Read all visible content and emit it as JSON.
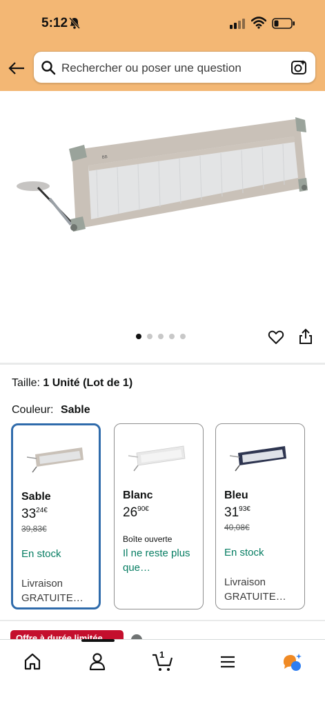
{
  "status_bar": {
    "time": "5:12"
  },
  "search": {
    "placeholder": "Rechercher ou poser une question"
  },
  "gallery": {
    "image_count": 5,
    "active_index": 0
  },
  "size": {
    "label": "Taille:",
    "value": "1 Unité (Lot de 1)"
  },
  "color": {
    "label": "Couleur:",
    "value": "Sable"
  },
  "variants": [
    {
      "name": "Sable",
      "price_whole": "33",
      "price_fraction": "24",
      "currency": "€",
      "old_price": "39,83€",
      "availability": "En stock",
      "delivery_line1": "Livraison",
      "delivery_line2": "GRATUITE…",
      "selected": true
    },
    {
      "name": "Blanc",
      "price_whole": "26",
      "price_fraction": "90",
      "currency": "€",
      "note": "Boîte ouverte",
      "availability": "Il ne reste plus que…",
      "selected": false
    },
    {
      "name": "Bleu",
      "price_whole": "31",
      "price_fraction": "93",
      "currency": "€",
      "old_price": "40,08€",
      "availability": "En stock",
      "delivery_line1": "Livraison",
      "delivery_line2": "GRATUITE…",
      "selected": false
    }
  ],
  "promo_badge": "Offre à durée limitée",
  "cart": {
    "count": "1"
  },
  "colors": {
    "header": "#f3b774",
    "selected_border": "#2f6bab",
    "in_stock": "#067d62",
    "badge": "#c40f2d"
  },
  "icons": [
    "back-arrow-icon",
    "search-icon",
    "camera-icon",
    "heart-icon",
    "share-icon",
    "home-icon",
    "account-icon",
    "cart-icon",
    "menu-icon",
    "rufus-ai-icon"
  ]
}
